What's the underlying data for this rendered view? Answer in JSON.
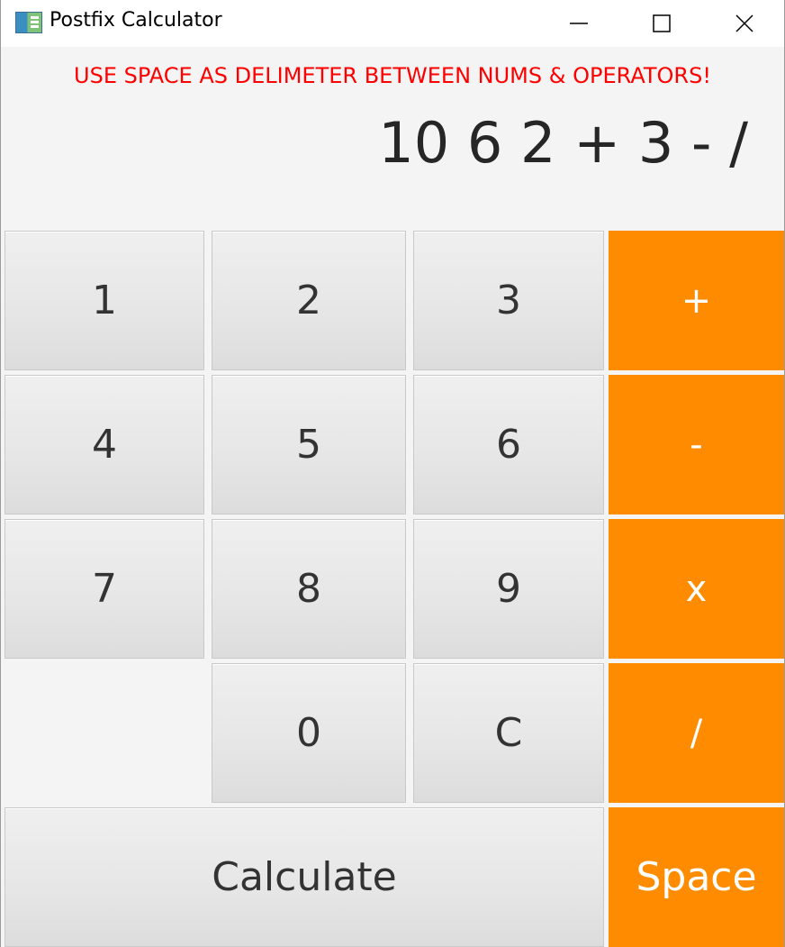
{
  "window": {
    "title": "Postfix Calculator",
    "icon": "app-icon"
  },
  "hint": "USE SPACE AS DELIMETER BETWEEN NUMS & OPERATORS!",
  "display": "10 6 2 + 3 - /",
  "keys": {
    "k1": "1",
    "k2": "2",
    "k3": "3",
    "plus": "+",
    "k4": "4",
    "k5": "5",
    "k6": "6",
    "minus": "-",
    "k7": "7",
    "k8": "8",
    "k9": "9",
    "times": "x",
    "k0": "0",
    "clear": "C",
    "divide": "/",
    "calculate": "Calculate",
    "space": "Space"
  },
  "colors": {
    "operator": "#ff8c00",
    "hint": "#ff0000",
    "display_text": "#262626"
  }
}
